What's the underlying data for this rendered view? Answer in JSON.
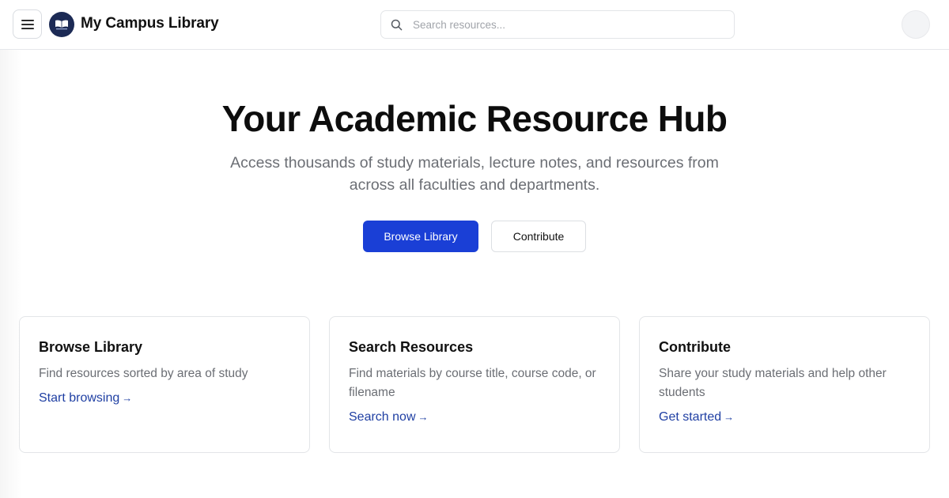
{
  "header": {
    "site_title": "My Campus Library",
    "search_placeholder": "Search resources..."
  },
  "hero": {
    "title": "Your Academic Resource Hub",
    "subtitle": "Access thousands of study materials, lecture notes, and resources from across all faculties and departments.",
    "primary_button": "Browse Library",
    "secondary_button": "Contribute"
  },
  "cards": [
    {
      "title": "Browse Library",
      "description": "Find resources sorted by area of study",
      "link": "Start browsing",
      "link_arrow": "→"
    },
    {
      "title": "Search Resources",
      "description": "Find materials by course title, course code, or filename",
      "link": "Search now",
      "link_arrow": "→"
    },
    {
      "title": "Contribute",
      "description": "Share your study materials and help other students",
      "link": "Get started",
      "link_arrow": "→"
    }
  ],
  "icons": {
    "menu": "hamburger-menu-icon",
    "logo": "open-book-logo-icon",
    "search": "search-icon",
    "avatar": "user-avatar"
  },
  "colors": {
    "primary": "#1a3fd6",
    "link": "#1f3fa3",
    "logo_bg": "#1c2a55",
    "muted_text": "#6b6e74"
  }
}
